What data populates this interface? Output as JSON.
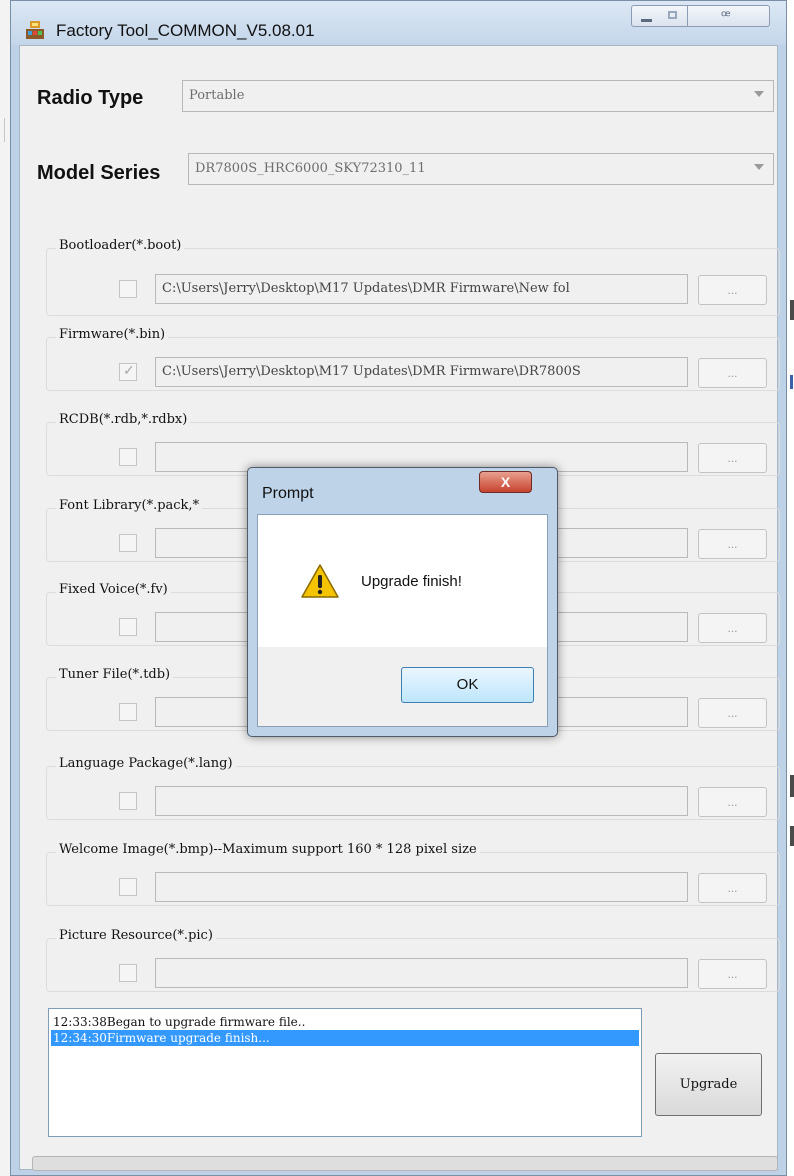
{
  "window": {
    "title": "Factory Tool_COMMON_V5.08.01",
    "close_glyph": "ꟹ"
  },
  "radio_type": {
    "label": "Radio Type",
    "value": "Portable"
  },
  "model_series": {
    "label": "Model Series",
    "value": "DR7800S_HRC6000_SKY72310_11"
  },
  "browse_label": "...",
  "files": [
    {
      "label": "Bootloader(*.boot)",
      "checked": false,
      "path": "C:\\Users\\Jerry\\Desktop\\M17 Updates\\DMR Firmware\\New fol"
    },
    {
      "label": "Firmware(*.bin)",
      "checked": true,
      "path": "C:\\Users\\Jerry\\Desktop\\M17 Updates\\DMR Firmware\\DR7800S"
    },
    {
      "label": "RCDB(*.rdb,*.rdbx)",
      "checked": false,
      "path": ""
    },
    {
      "label": "Font Library(*.pack,*",
      "checked": false,
      "path": ""
    },
    {
      "label": "Fixed Voice(*.fv)",
      "checked": false,
      "path": ""
    },
    {
      "label": "Tuner File(*.tdb)",
      "checked": false,
      "path": ""
    },
    {
      "label": "Language Package(*.lang)",
      "checked": false,
      "path": ""
    },
    {
      "label": "Welcome Image(*.bmp)--Maximum support 160 * 128 pixel size",
      "checked": false,
      "path": ""
    },
    {
      "label": "Picture Resource(*.pic)",
      "checked": false,
      "path": ""
    }
  ],
  "log": [
    {
      "text": "12:33:38Began to upgrade firmware file..",
      "selected": false
    },
    {
      "text": "12:34:30Firmware upgrade finish...",
      "selected": true
    }
  ],
  "upgrade_label": "Upgrade",
  "dialog": {
    "title": "Prompt",
    "close_glyph": "X",
    "message": "Upgrade finish!",
    "ok_label": "OK"
  },
  "colors": {
    "selection": "#3399ff",
    "dialog_close": "#c7432f",
    "warning_icon": "#f5c400"
  }
}
